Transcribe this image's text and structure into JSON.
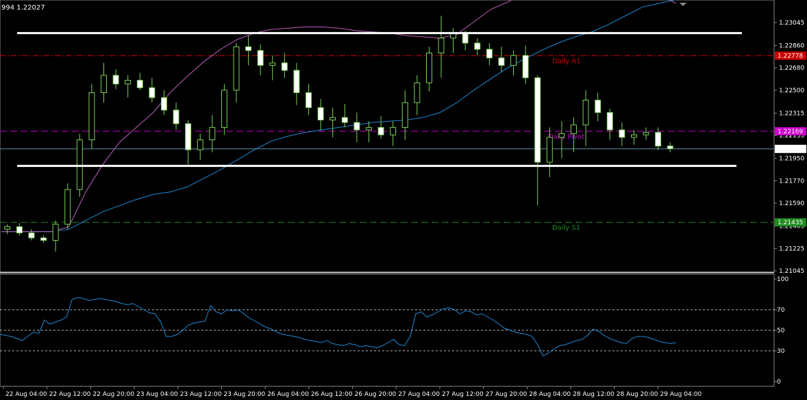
{
  "header": {
    "text": "994 1.22027"
  },
  "chart_data": [
    {
      "type": "candlestick",
      "price_ticks": [
        "1.23045",
        "1.22860",
        "1.22680",
        "1.22500",
        "1.22315",
        "1.22135",
        "1.21950",
        "1.21770",
        "1.21590",
        "1.21405",
        "1.21225",
        "1.21045"
      ],
      "ylim": [
        1.21045,
        1.23135
      ],
      "time_ticks": [
        "22 Aug 04:00",
        "22 Aug 12:00",
        "22 Aug 20:00",
        "23 Aug 04:00",
        "23 Aug 12:00",
        "23 Aug 20:00",
        "26 Aug 04:00",
        "26 Aug 12:00",
        "26 Aug 20:00",
        "27 Aug 04:00",
        "27 Aug 12:00",
        "27 Aug 20:00",
        "28 Aug 04:00",
        "28 Aug 12:00",
        "28 Aug 20:00",
        "29 Aug 04:00"
      ],
      "levels": [
        {
          "name": "Daily R1",
          "value": 1.22778,
          "label": "1.22778",
          "color": "#cc0000",
          "style": "dashdot"
        },
        {
          "name": "Daily Pivot",
          "value": 1.22169,
          "label": "1.22169",
          "color": "#cc00cc",
          "style": "dash"
        },
        {
          "name": "Daily S1",
          "value": 1.21435,
          "label": "1.21435",
          "color": "#1e8c1e",
          "style": "dash"
        }
      ],
      "level_text": {
        "r1": "Daily R1",
        "pivot": "Daily Pivot",
        "s1": "Daily S1"
      },
      "current_price": {
        "value": 1.22027,
        "label": "1.22027"
      },
      "range_lines": [
        1.2296,
        1.2189
      ],
      "colors": {
        "bull": "#ffffff",
        "bear": "#ffffff",
        "wick": "#7dd35a",
        "ma_slow": "#1f8ad6",
        "ma_fast": "#c060c0",
        "range": "#ffffff"
      },
      "ma_fast": [
        1.2136,
        1.2136,
        1.2136,
        1.2136,
        1.214,
        1.2168,
        1.219,
        1.2208,
        1.222,
        1.2232,
        1.2248,
        1.2261,
        1.2273,
        1.2283,
        1.2291,
        1.2296,
        1.2299,
        1.23,
        1.2301,
        1.2301,
        1.23,
        1.2298,
        1.2297,
        1.2296,
        1.2294,
        1.2293,
        1.2292,
        1.2295,
        1.2305,
        1.2315,
        1.2321,
        1.2328,
        1.2333,
        1.2337,
        1.234,
        1.234,
        1.2338,
        1.2336,
        1.2334,
        1.2327,
        1.232
      ],
      "ma_slow": [
        1.2136,
        1.2136,
        1.2136,
        1.2136,
        1.2138,
        1.2145,
        1.2152,
        1.2157,
        1.2162,
        1.2166,
        1.2168,
        1.2172,
        1.2179,
        1.2186,
        1.2194,
        1.2202,
        1.2209,
        1.2213,
        1.2216,
        1.2218,
        1.222,
        1.2222,
        1.2224,
        1.2225,
        1.2226,
        1.2228,
        1.2232,
        1.224,
        1.225,
        1.2259,
        1.2268,
        1.2275,
        1.2282,
        1.2288,
        1.2293,
        1.2297,
        1.2303,
        1.231,
        1.2317,
        1.232,
        1.2323
      ],
      "candles": [
        [
          1.2138,
          1.2142,
          1.2134,
          1.214
        ],
        [
          1.214,
          1.2143,
          1.2133,
          1.2135
        ],
        [
          1.2135,
          1.2138,
          1.2129,
          1.2131
        ],
        [
          1.2131,
          1.2133,
          1.2127,
          1.2129
        ],
        [
          1.2129,
          1.2145,
          1.212,
          1.2142
        ],
        [
          1.2142,
          1.2175,
          1.2138,
          1.217
        ],
        [
          1.217,
          1.2215,
          1.2164,
          1.221
        ],
        [
          1.221,
          1.2255,
          1.2203,
          1.2248
        ],
        [
          1.2248,
          1.2272,
          1.224,
          1.2262
        ],
        [
          1.2262,
          1.2267,
          1.2251,
          1.2255
        ],
        [
          1.2255,
          1.2262,
          1.2244,
          1.2258
        ],
        [
          1.2258,
          1.2264,
          1.225,
          1.2252
        ],
        [
          1.2252,
          1.226,
          1.224,
          1.2244
        ],
        [
          1.2244,
          1.225,
          1.223,
          1.2234
        ],
        [
          1.2234,
          1.224,
          1.2218,
          1.2223
        ],
        [
          1.2223,
          1.2226,
          1.219,
          1.2202
        ],
        [
          1.2202,
          1.2215,
          1.2194,
          1.221
        ],
        [
          1.221,
          1.223,
          1.22,
          1.222
        ],
        [
          1.222,
          1.2255,
          1.2214,
          1.225
        ],
        [
          1.225,
          1.2288,
          1.224,
          1.2285
        ],
        [
          1.2285,
          1.2294,
          1.227,
          1.2282
        ],
        [
          1.2282,
          1.2287,
          1.2262,
          1.227
        ],
        [
          1.227,
          1.2278,
          1.2258,
          1.2272
        ],
        [
          1.2272,
          1.228,
          1.226,
          1.2266
        ],
        [
          1.2266,
          1.2272,
          1.2238,
          1.2248
        ],
        [
          1.2248,
          1.2255,
          1.223,
          1.2236
        ],
        [
          1.2236,
          1.2243,
          1.2218,
          1.2226
        ],
        [
          1.2226,
          1.2236,
          1.2212,
          1.2228
        ],
        [
          1.2228,
          1.2239,
          1.222,
          1.2224
        ],
        [
          1.2224,
          1.2232,
          1.2208,
          1.2218
        ],
        [
          1.2218,
          1.2225,
          1.2208,
          1.222
        ],
        [
          1.222,
          1.2229,
          1.2211,
          1.2214
        ],
        [
          1.2214,
          1.2225,
          1.2205,
          1.222
        ],
        [
          1.222,
          1.225,
          1.221,
          1.224
        ],
        [
          1.224,
          1.2262,
          1.223,
          1.2256
        ],
        [
          1.2256,
          1.2285,
          1.2249,
          1.228
        ],
        [
          1.228,
          1.231,
          1.226,
          1.2292
        ],
        [
          1.2292,
          1.23,
          1.228,
          1.2296
        ],
        [
          1.2296,
          1.2298,
          1.2282,
          1.2288
        ],
        [
          1.2288,
          1.2292,
          1.2278,
          1.2283
        ],
        [
          1.2283,
          1.2288,
          1.227,
          1.2276
        ],
        [
          1.2276,
          1.2285,
          1.2265,
          1.227
        ],
        [
          1.227,
          1.2282,
          1.2262,
          1.2278
        ],
        [
          1.2278,
          1.2286,
          1.2255,
          1.226
        ],
        [
          1.226,
          1.2262,
          1.2157,
          1.2192
        ],
        [
          1.2192,
          1.222,
          1.218,
          1.2212
        ],
        [
          1.2212,
          1.2225,
          1.2195,
          1.2215
        ],
        [
          1.2215,
          1.2228,
          1.22,
          1.2222
        ],
        [
          1.2222,
          1.225,
          1.2205,
          1.2242
        ],
        [
          1.2242,
          1.2248,
          1.2225,
          1.2232
        ],
        [
          1.2232,
          1.2235,
          1.221,
          1.2218
        ],
        [
          1.2218,
          1.2224,
          1.2205,
          1.2212
        ],
        [
          1.2212,
          1.2218,
          1.2206,
          1.2214
        ],
        [
          1.2214,
          1.222,
          1.221,
          1.2216
        ],
        [
          1.2216,
          1.222,
          1.2202,
          1.2205
        ],
        [
          1.2205,
          1.2208,
          1.22,
          1.2203
        ]
      ]
    },
    {
      "type": "line",
      "name": "RSI",
      "ylim": [
        0,
        100
      ],
      "ticks": [
        "100",
        "70",
        "50",
        "30",
        "0"
      ],
      "levels": [
        70,
        50,
        30
      ],
      "color": "#1f8ad6",
      "values": [
        46,
        45,
        44,
        42,
        40,
        44,
        48,
        47,
        60,
        56,
        58,
        60,
        63,
        80,
        82,
        81,
        79,
        80,
        81,
        80,
        79,
        78,
        76,
        75,
        76,
        73,
        70,
        67,
        66,
        58,
        44,
        44,
        46,
        50,
        55,
        57,
        58,
        59,
        74,
        68,
        66,
        70,
        69,
        70,
        66,
        62,
        59,
        56,
        53,
        51,
        48,
        46,
        45,
        44,
        43,
        41,
        40,
        39,
        38,
        40,
        37,
        36,
        35,
        37,
        36,
        34,
        35,
        34,
        33,
        35,
        38,
        41,
        36,
        35,
        44,
        66,
        68,
        63,
        65,
        68,
        71,
        72,
        70,
        66,
        69,
        68,
        65,
        66,
        63,
        60,
        56,
        52,
        50,
        48,
        47,
        46,
        44,
        36,
        25,
        28,
        32,
        35,
        36,
        38,
        40,
        41,
        45,
        51,
        49,
        45,
        42,
        40,
        38,
        37,
        42,
        44,
        44,
        43,
        41,
        39,
        38,
        37,
        38
      ]
    }
  ]
}
